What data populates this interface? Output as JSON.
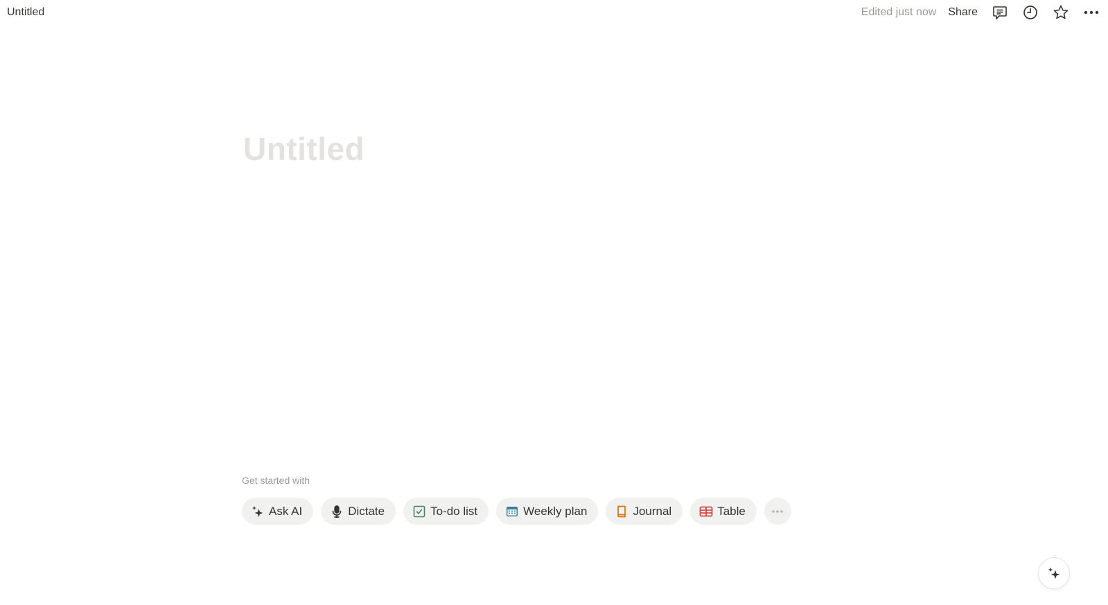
{
  "topbar": {
    "breadcrumb_title": "Untitled",
    "edited_status": "Edited just now",
    "share_label": "Share",
    "icons": [
      "comments-icon",
      "history-clock-icon",
      "favorite-star-icon",
      "more-options-icon"
    ]
  },
  "page": {
    "title_placeholder": "Untitled"
  },
  "get_started": {
    "label": "Get started with",
    "chips": [
      {
        "label": "Ask AI",
        "icon": "sparkles-icon",
        "color": "#37352f"
      },
      {
        "label": "Dictate",
        "icon": "microphone-icon",
        "color": "#37352f"
      },
      {
        "label": "To-do list",
        "icon": "checkbox-icon",
        "color": "#448361"
      },
      {
        "label": "Weekly plan",
        "icon": "calendar-icon",
        "color": "#337ea9"
      },
      {
        "label": "Journal",
        "icon": "book-icon",
        "color": "#d9730d"
      },
      {
        "label": "Table",
        "icon": "table-icon",
        "color": "#d44c47"
      }
    ],
    "more_icon": "more-options-icon"
  },
  "ai_button": {
    "icon": "sparkles-icon"
  }
}
